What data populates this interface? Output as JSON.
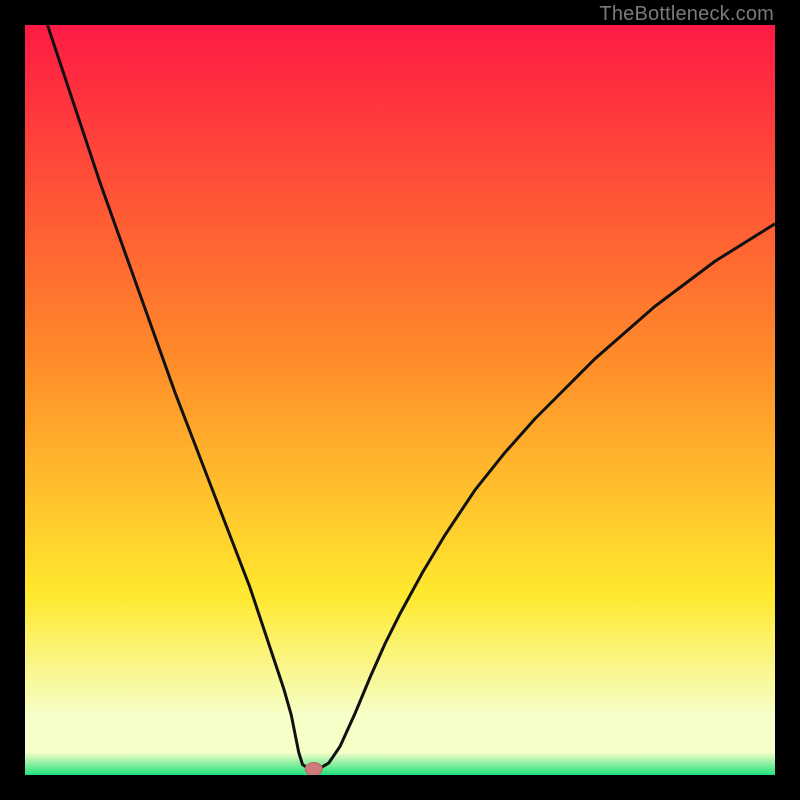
{
  "watermark": "TheBottleneck.com",
  "colors": {
    "top_red": "#ff1a44",
    "orange": "#ff8a2a",
    "yellow": "#ffe92e",
    "pale": "#f6ffc8",
    "green": "#20e07a",
    "curve": "#111111",
    "marker_fill": "#cf7b79",
    "marker_stroke": "#b96763"
  },
  "chart_data": {
    "type": "line",
    "title": "",
    "xlabel": "",
    "ylabel": "",
    "xlim": [
      0,
      100
    ],
    "ylim": [
      0,
      100
    ],
    "curve": {
      "name": "bottleneck-v-curve",
      "x": [
        3,
        5,
        7.5,
        10,
        12.5,
        15,
        17.5,
        20,
        22.5,
        25,
        27.5,
        30,
        31.5,
        33,
        34.5,
        35.5,
        36,
        36.5,
        37,
        38,
        39,
        40.5,
        42,
        44,
        46,
        48,
        50,
        53,
        56,
        60,
        64,
        68,
        72,
        76,
        80,
        84,
        88,
        92,
        96,
        100
      ],
      "y": [
        100,
        94,
        86.5,
        79,
        72,
        65,
        58,
        51,
        44.5,
        38,
        31.5,
        25,
        20.5,
        16,
        11.5,
        8,
        5.5,
        3,
        1.4,
        0.7,
        0.7,
        1.6,
        3.8,
        8.2,
        13,
        17.5,
        21.5,
        27,
        32,
        38,
        43,
        47.5,
        51.5,
        55.5,
        59,
        62.5,
        65.5,
        68.5,
        71,
        73.5
      ]
    },
    "marker": {
      "x": 38.5,
      "y": 0.8
    }
  }
}
